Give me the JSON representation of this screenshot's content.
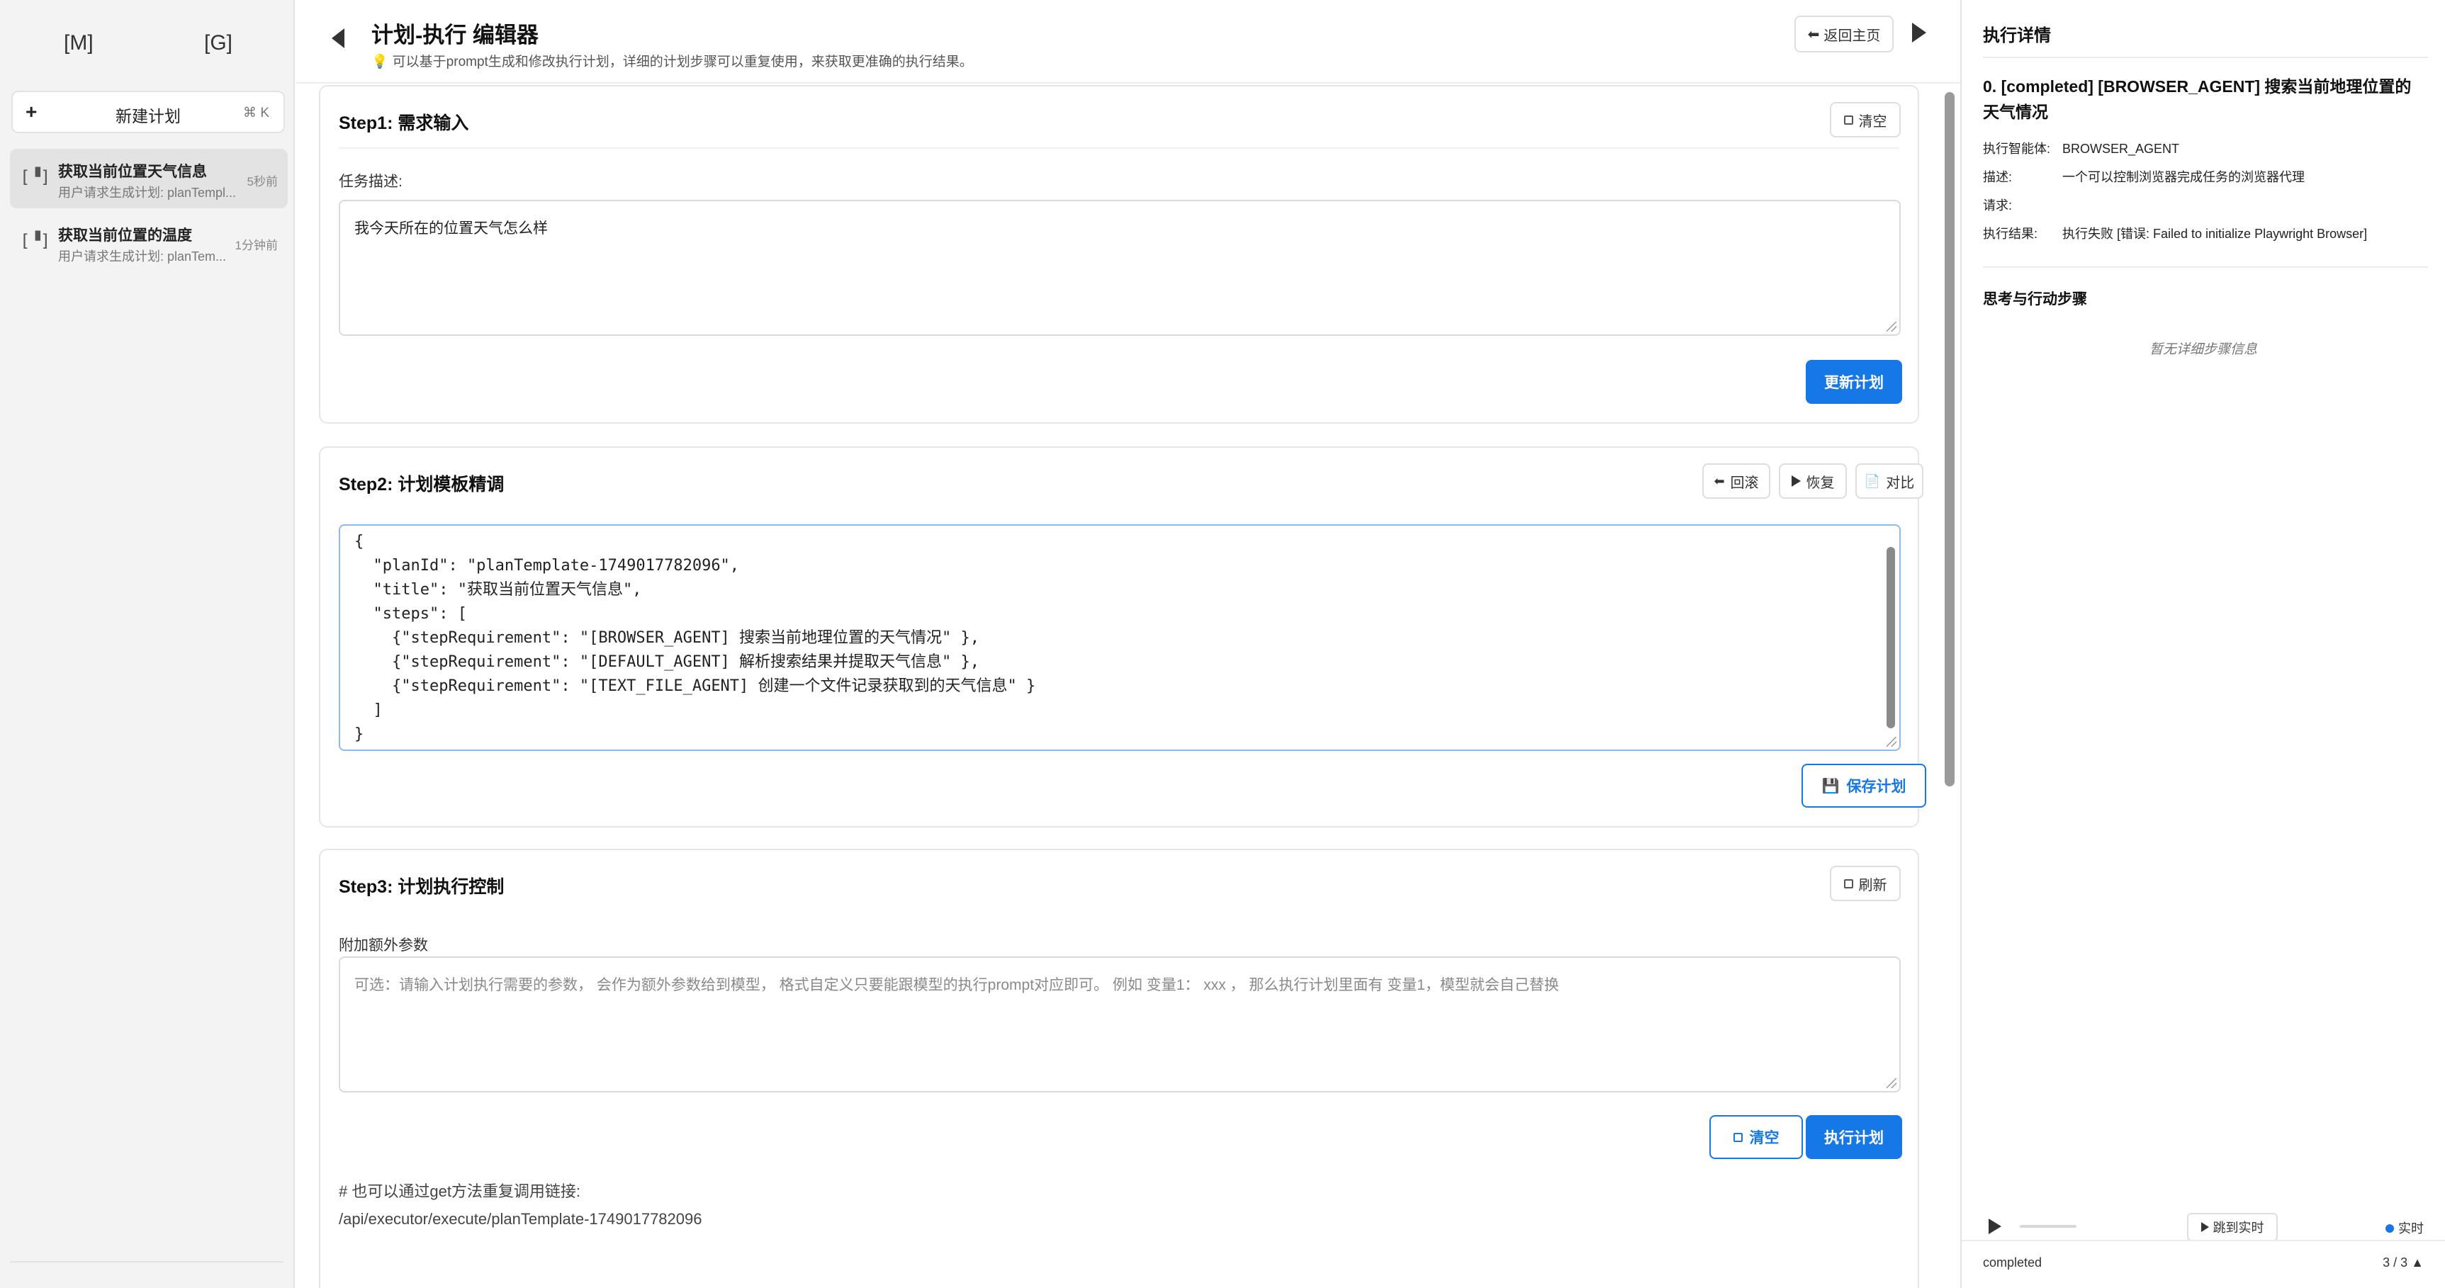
{
  "sidebar": {
    "tabs": [
      "[M]",
      "[G]"
    ],
    "new_plan": {
      "plus": "+",
      "label": "新建计划",
      "shortcut": "⌘ K"
    },
    "plans": [
      {
        "icon": "[▝]",
        "title": "获取当前位置天气信息",
        "subtitle": "用户请求生成计划: planTempl...",
        "time": "5秒前",
        "active": true
      },
      {
        "icon": "[▝]",
        "title": "获取当前位置的温度",
        "subtitle": "用户请求生成计划: planTem...",
        "time": "1分钟前",
        "active": false
      }
    ]
  },
  "header": {
    "title": "计划-执行 编辑器",
    "subtitle_icon": "💡",
    "subtitle": "可以基于prompt生成和修改执行计划，详细的计划步骤可以重复使用，来获取更准确的执行结果。",
    "home_button": "返回主页"
  },
  "step1": {
    "title": "Step1: 需求输入",
    "clear_button": "清空",
    "field_label": "任务描述:",
    "task_value": "我今天所在的位置天气怎么样",
    "update_button": "更新计划"
  },
  "step2": {
    "title": "Step2: 计划模板精调",
    "rollback_button": "回滚",
    "restore_button": "恢复",
    "compare_button": "对比",
    "json_text": "{\n  \"planId\": \"planTemplate-1749017782096\",\n  \"title\": \"获取当前位置天气信息\",\n  \"steps\": [\n    {\"stepRequirement\": \"[BROWSER_AGENT] 搜索当前地理位置的天气情况\" },\n    {\"stepRequirement\": \"[DEFAULT_AGENT] 解析搜索结果并提取天气信息\" },\n    {\"stepRequirement\": \"[TEXT_FILE_AGENT] 创建一个文件记录获取到的天气信息\" }\n  ]\n}",
    "save_button": "保存计划"
  },
  "step3": {
    "title": "Step3: 计划执行控制",
    "refresh_button": "刷新",
    "field_label": "附加额外参数",
    "placeholder": "可选：请输入计划执行需要的参数， 会作为额外参数给到模型， 格式自定义只要能跟模型的执行prompt对应即可。 例如 变量1： xxx ， 那么执行计划里面有 变量1，模型就会自己替换",
    "clear_button": "清空",
    "execute_button": "执行计划",
    "link_note": "# 也可以通过get方法重复调用链接:",
    "link_url": "/api/executor/execute/planTemplate-1749017782096"
  },
  "right_panel": {
    "title": "执行详情",
    "step_heading": "0. [completed] [BROWSER_AGENT] 搜索当前地理位置的天气情况",
    "details": [
      {
        "key": "执行智能体:",
        "value": "BROWSER_AGENT"
      },
      {
        "key": "描述:",
        "value": "一个可以控制浏览器完成任务的浏览器代理"
      },
      {
        "key": "请求:",
        "value": ""
      },
      {
        "key": "执行结果:",
        "value": "执行失败 [错误: Failed to initialize Playwright Browser]"
      }
    ],
    "thinking_title": "思考与行动步骤",
    "empty_text": "暂无详细步骤信息",
    "jump_button": "跳到实时",
    "live_label": "实时",
    "status": "completed",
    "count": "3 / 3 ▲"
  },
  "colors": {
    "primary": "#1677e6",
    "sidebar_bg": "#f3f3f3",
    "active_item": "#e3e3e3"
  }
}
